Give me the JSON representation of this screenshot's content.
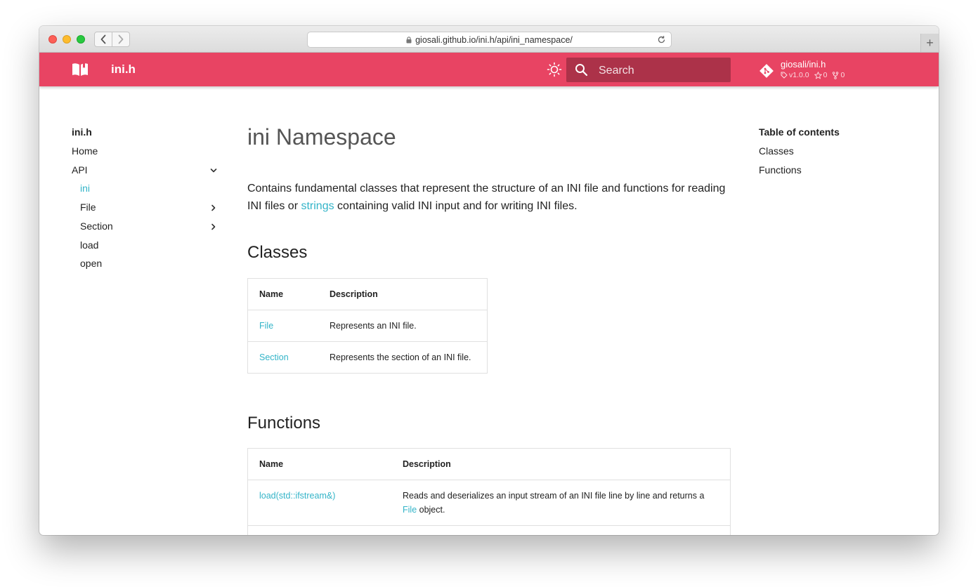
{
  "browser": {
    "url": "giosali.github.io/ini.h/api/ini_namespace/",
    "new_tab": "+"
  },
  "header": {
    "site_title": "ini.h",
    "search_placeholder": "Search",
    "repo_name": "giosali/ini.h",
    "repo_version": "v1.0.0",
    "repo_stars": "0",
    "repo_forks": "0",
    "accent_color": "#e84463"
  },
  "nav": {
    "title": "ini.h",
    "items": [
      {
        "label": "Home"
      },
      {
        "label": "API"
      },
      {
        "label": "ini"
      },
      {
        "label": "File"
      },
      {
        "label": "Section"
      },
      {
        "label": "load"
      },
      {
        "label": "open"
      }
    ]
  },
  "main": {
    "title": "ini Namespace",
    "intro_before": "Contains fundamental classes that represent the structure of an INI file and functions for reading INI files or ",
    "intro_link": "strings",
    "intro_after": " containing valid INI input and for writing INI files.",
    "classes_heading": "Classes",
    "classes_table": {
      "headers": [
        "Name",
        "Description"
      ],
      "rows": [
        {
          "name": "File",
          "description": "Represents an INI file."
        },
        {
          "name": "Section",
          "description": "Represents the section of an INI file."
        }
      ]
    },
    "functions_heading": "Functions",
    "functions_table": {
      "headers": [
        "Name",
        "Description"
      ],
      "rows": [
        {
          "name": "load(std::ifstream&)",
          "description_before": "Reads and deserializes an input stream of an INI file line by line and returns a ",
          "description_link": "File",
          "description_after": " object."
        }
      ]
    }
  },
  "toc": {
    "title": "Table of contents",
    "items": [
      "Classes",
      "Functions"
    ]
  }
}
